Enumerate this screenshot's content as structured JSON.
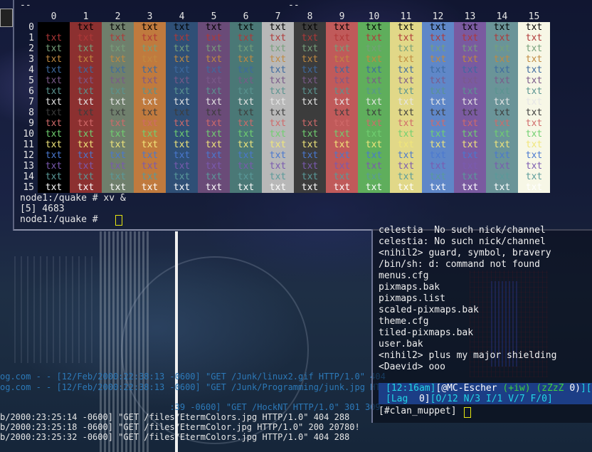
{
  "top_terminal": {
    "dash_left": "--",
    "dash_right": "--",
    "column_headers": [
      "0",
      "1",
      "2",
      "3",
      "4",
      "5",
      "6",
      "7",
      "8",
      "9",
      "10",
      "11",
      "12",
      "13",
      "14",
      "15"
    ],
    "row_labels": [
      "0",
      "1",
      "2",
      "3",
      "4",
      "5",
      "6",
      "7",
      "8",
      "9",
      "10",
      "11",
      "12",
      "13",
      "14",
      "15"
    ],
    "cell_text": "txt",
    "bg_colors": [
      "#000000",
      "#8c3030",
      "#6f7f6c",
      "#c07a3e",
      "#2f4f76",
      "#6a4b78",
      "#4a7876",
      "#b8b8b8",
      "#3c3c3c",
      "#c05a5a",
      "#5fae5c",
      "#e1d888",
      "#5f87c8",
      "#7a5aa0",
      "#6a9498",
      "#f7f7e6"
    ],
    "fg_colors": [
      "#000000",
      "#b03838",
      "#76a07a",
      "#c08a40",
      "#3d6aa0",
      "#7a5a8a",
      "#5a9490",
      "#e6e6e6",
      "#3c3c3c",
      "#d06a6a",
      "#70d070",
      "#f0e67a",
      "#4a78d0",
      "#7a5ab0",
      "#5a9a9a",
      "#ffffff"
    ],
    "prompt_lines": [
      "node1:/quake # xv &",
      "[5] 4683",
      "node1:/quake # "
    ]
  },
  "log_lines": [
    {
      "text": "og.com - - [12/Feb/2000:22:38:13 -0600] \"GET /Junk/linux2.gif HTTP/1.0\" 404",
      "color": "blue"
    },
    {
      "text": "og.com - - [12/Feb/2000:22:38:13 -0600] \"GET /Junk/Programming/junk.jpg HTT",
      "color": "blue"
    },
    {
      "text": "                                 :39 -0600] \"GET /HockNT HTTP/1.0\" 301 309",
      "color": "blue"
    },
    {
      "text": "b/2000:23:25:14 -0600] \"GET /files/EtermColors.jpg HTTP/1.0\" 404 288",
      "color": "white"
    },
    {
      "text": "b/2000:23:25:18 -0600] \"GET /files/EtermColor.jpg HTTP/1.0\" 200 20780!",
      "color": "white"
    },
    {
      "text": "b/2000:23:25:32 -0600] \"GET /files/EtermColors.jpg HTTP/1.0\" 404 288",
      "color": "white"
    }
  ],
  "irc": {
    "lines": [
      "celestia  No such nick/channel",
      "celestia: No such nick/channel",
      "<nihil2> guard, symbol, bravery",
      "/bin/sh: d: command not found",
      "menus.cfg",
      "pixmaps.bak",
      "pixmaps.list",
      "scaled-pixmaps.bak",
      "theme.cfg",
      "tiled-pixmaps.bak",
      "user.bak",
      "<nihil2> plus my major shielding",
      "<Daevid> ooo"
    ],
    "status": {
      "time": "[12:16am]",
      "nick_open": "[@",
      "nick": "MC-Escher",
      "mode": "(+iw)",
      "zzz": "(zZzZ",
      "zzz_count": "0)",
      "tail": "][M",
      "lag_label": "[Lag",
      "lag_value": "0]",
      "counts": "[O/12 N/3 I/1 V/7 F/0]"
    },
    "channel": "[#clan_muppet]"
  }
}
